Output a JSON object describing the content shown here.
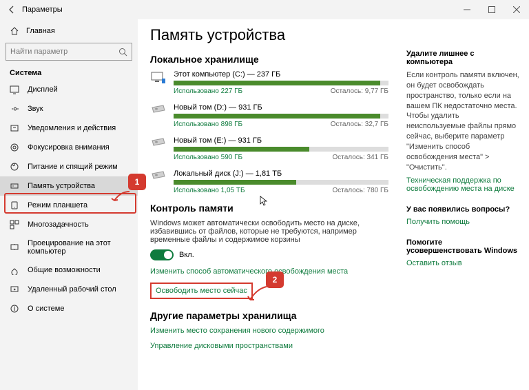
{
  "window": {
    "title": "Параметры"
  },
  "sidebar": {
    "home": "Главная",
    "search_placeholder": "Найти параметр",
    "section": "Система",
    "items": [
      "Дисплей",
      "Звук",
      "Уведомления и действия",
      "Фокусировка внимания",
      "Питание и спящий режим",
      "Память устройства",
      "Режим планшета",
      "Многозадачность",
      "Проецирование на этот компьютер",
      "Общие возможности",
      "Удаленный рабочий стол",
      "О системе"
    ],
    "active_index": 5
  },
  "main": {
    "title": "Память устройства",
    "local_heading": "Локальное хранилище",
    "drives": [
      {
        "name": "Этот компьютер (C:) — 237 ГБ",
        "used_pct": 96,
        "used": "Использовано 227 ГБ",
        "free": "Осталось: 9,77 ГБ",
        "icon": "pc"
      },
      {
        "name": "Новый том (D:) — 931 ГБ",
        "used_pct": 96,
        "used": "Использовано 898 ГБ",
        "free": "Осталось: 32,7 ГБ",
        "icon": "hdd"
      },
      {
        "name": "Новый том (E:) — 931 ГБ",
        "used_pct": 63,
        "used": "Использовано 590 ГБ",
        "free": "Осталось: 341 ГБ",
        "icon": "hdd"
      },
      {
        "name": "Локальный диск (J:) — 1,81 ТБ",
        "used_pct": 57,
        "used": "Использовано 1,05 ТБ",
        "free": "Осталось: 780 ГБ",
        "icon": "hdd"
      }
    ],
    "sense_heading": "Контроль памяти",
    "sense_desc": "Windows может автоматически освободить место на диске, избавившись от файлов, которые не требуются, например временные файлы и содержимое корзины",
    "toggle_label": "Вкл.",
    "sense_link1": "Изменить способ автоматического освобождения места",
    "sense_link2": "Освободить место сейчас",
    "other_heading": "Другие параметры хранилища",
    "other_link1": "Изменить место сохранения нового содержимого",
    "other_link2": "Управление дисковыми пространствами"
  },
  "right": {
    "h1": "Удалите лишнее с компьютера",
    "p1": "Если контроль памяти включен, он будет освобождать пространство, только если на вашем ПК недостаточно места. Чтобы удалить неиспользуемые файлы прямо сейчас, выберите параметр \"Изменить способ освобождения места\" > \"Очистить\".",
    "link1": "Техническая поддержка по освобождению места на диске",
    "h2": "У вас появились вопросы?",
    "link2": "Получить помощь",
    "h3": "Помогите усовершенствовать Windows",
    "link3": "Оставить отзыв"
  },
  "badges": {
    "one": "1",
    "two": "2"
  }
}
